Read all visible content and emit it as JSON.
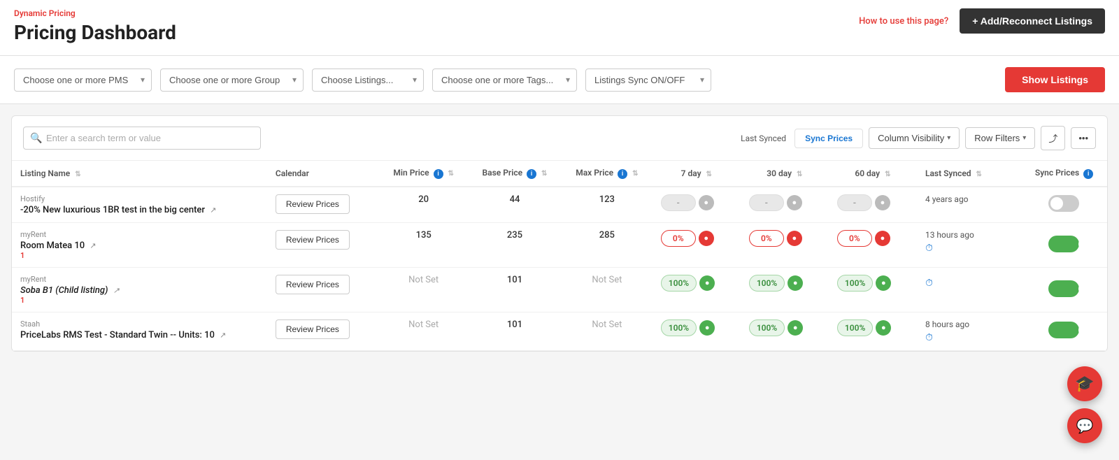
{
  "header": {
    "dynamic_pricing_label": "Dynamic Pricing",
    "page_title": "Pricing Dashboard",
    "how_to_link": "How to use this page?",
    "add_btn_label": "+ Add/Reconnect Listings"
  },
  "filters": {
    "pms_placeholder": "Choose one or more PMS",
    "group_placeholder": "Choose one or more Group",
    "listings_placeholder": "Choose Listings...",
    "tags_placeholder": "Choose one or more Tags...",
    "sync_placeholder": "Listings Sync ON/OFF",
    "show_listings_btn": "Show Listings"
  },
  "toolbar": {
    "search_placeholder": "Enter a search term or value",
    "col_visibility_label": "Column Visibility",
    "row_filters_label": "Row Filters",
    "sync_prices_label": "Sync Prices",
    "last_synced_label": "Last Synced"
  },
  "table": {
    "columns": [
      {
        "key": "listing_name",
        "label": "Listing Name",
        "has_sort": true,
        "has_info": false
      },
      {
        "key": "calendar",
        "label": "Calendar",
        "has_sort": false,
        "has_info": false
      },
      {
        "key": "min_price",
        "label": "Min Price",
        "has_sort": true,
        "has_info": true
      },
      {
        "key": "base_price",
        "label": "Base Price",
        "has_sort": true,
        "has_info": true
      },
      {
        "key": "max_price",
        "label": "Max Price",
        "has_sort": true,
        "has_info": true
      },
      {
        "key": "day7",
        "label": "7 day",
        "has_sort": true,
        "has_info": false
      },
      {
        "key": "day30",
        "label": "30 day",
        "has_sort": true,
        "has_info": false
      },
      {
        "key": "day60",
        "label": "60 day",
        "has_sort": true,
        "has_info": false
      },
      {
        "key": "last_synced",
        "label": "Last Synced",
        "has_sort": true,
        "has_info": false
      },
      {
        "key": "sync_prices",
        "label": "Sync Prices",
        "has_sort": false,
        "has_info": true
      }
    ],
    "rows": [
      {
        "id": "row1",
        "group": "Hostify",
        "name": "-20% New luxurious 1BR test in the big center",
        "italic": false,
        "has_link": true,
        "error": null,
        "calendar_btn": "Review Prices",
        "min_price": "20",
        "base_price": "44",
        "max_price": "123",
        "min_not_set": false,
        "max_not_set": false,
        "day7_val": "-",
        "day7_type": "gray",
        "day30_val": "-",
        "day30_type": "gray",
        "day60_val": "-",
        "day60_type": "gray",
        "last_synced": "4 years ago",
        "last_synced_icon": false,
        "sync_on": false
      },
      {
        "id": "row2",
        "group": "myRent",
        "name": "Room Matea 10",
        "italic": false,
        "has_link": true,
        "error": "1",
        "calendar_btn": "Review Prices",
        "min_price": "135",
        "base_price": "235",
        "max_price": "285",
        "min_not_set": false,
        "max_not_set": false,
        "day7_val": "0%",
        "day7_type": "red",
        "day30_val": "0%",
        "day30_type": "red",
        "day60_val": "0%",
        "day60_type": "red",
        "last_synced": "13 hours ago",
        "last_synced_icon": true,
        "sync_on": true
      },
      {
        "id": "row3",
        "group": "myRent",
        "name": "Soba B1 (Child listing)",
        "italic": true,
        "has_link": true,
        "error": "1",
        "calendar_btn": "Review Prices",
        "min_price": null,
        "base_price": "101",
        "max_price": null,
        "min_not_set": true,
        "max_not_set": true,
        "day7_val": "100%",
        "day7_type": "green",
        "day30_val": "100%",
        "day30_type": "green",
        "day60_val": "100%",
        "day60_type": "green",
        "last_synced": "",
        "last_synced_icon": true,
        "sync_on": true
      },
      {
        "id": "row4",
        "group": "Staah",
        "name": "PriceLabs RMS Test - Standard Twin -- Units: 10",
        "italic": false,
        "has_link": true,
        "error": null,
        "calendar_btn": "Review Prices",
        "min_price": null,
        "base_price": "101",
        "max_price": null,
        "min_not_set": true,
        "max_not_set": true,
        "day7_val": "100%",
        "day7_type": "green",
        "day30_val": "100%",
        "day30_type": "green",
        "day60_val": "100%",
        "day60_type": "green",
        "last_synced": "8 hours ago",
        "last_synced_icon": true,
        "sync_on": true
      }
    ]
  },
  "fab": {
    "support_icon": "💬",
    "graduate_icon": "🎓"
  }
}
